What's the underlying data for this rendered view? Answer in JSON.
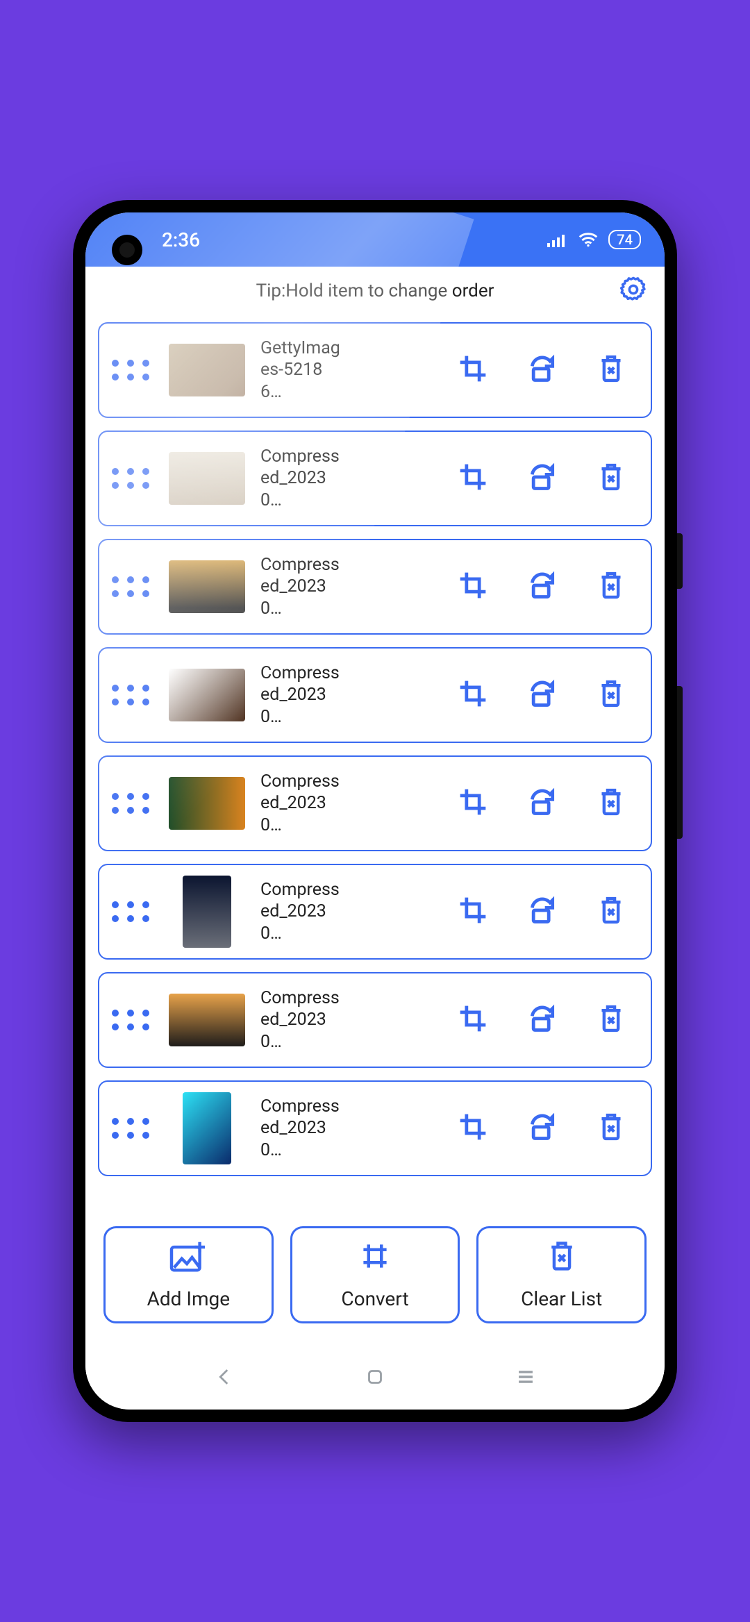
{
  "status": {
    "time": "2:36",
    "battery": "74"
  },
  "tip": "Tip:Hold item to change order",
  "items": [
    {
      "name": "GettyImages-52186…",
      "portrait": false
    },
    {
      "name": "Compressed_20230…",
      "portrait": false
    },
    {
      "name": "Compressed_20230…",
      "portrait": false
    },
    {
      "name": "Compressed_20230…",
      "portrait": false
    },
    {
      "name": "Compressed_20230…",
      "portrait": false
    },
    {
      "name": "Compressed_20230…",
      "portrait": true
    },
    {
      "name": "Compressed_20230…",
      "portrait": false
    },
    {
      "name": "Compressed_20230…",
      "portrait": true
    }
  ],
  "buttons": {
    "add": "Add Imge",
    "convert": "Convert",
    "clear": "Clear List"
  }
}
